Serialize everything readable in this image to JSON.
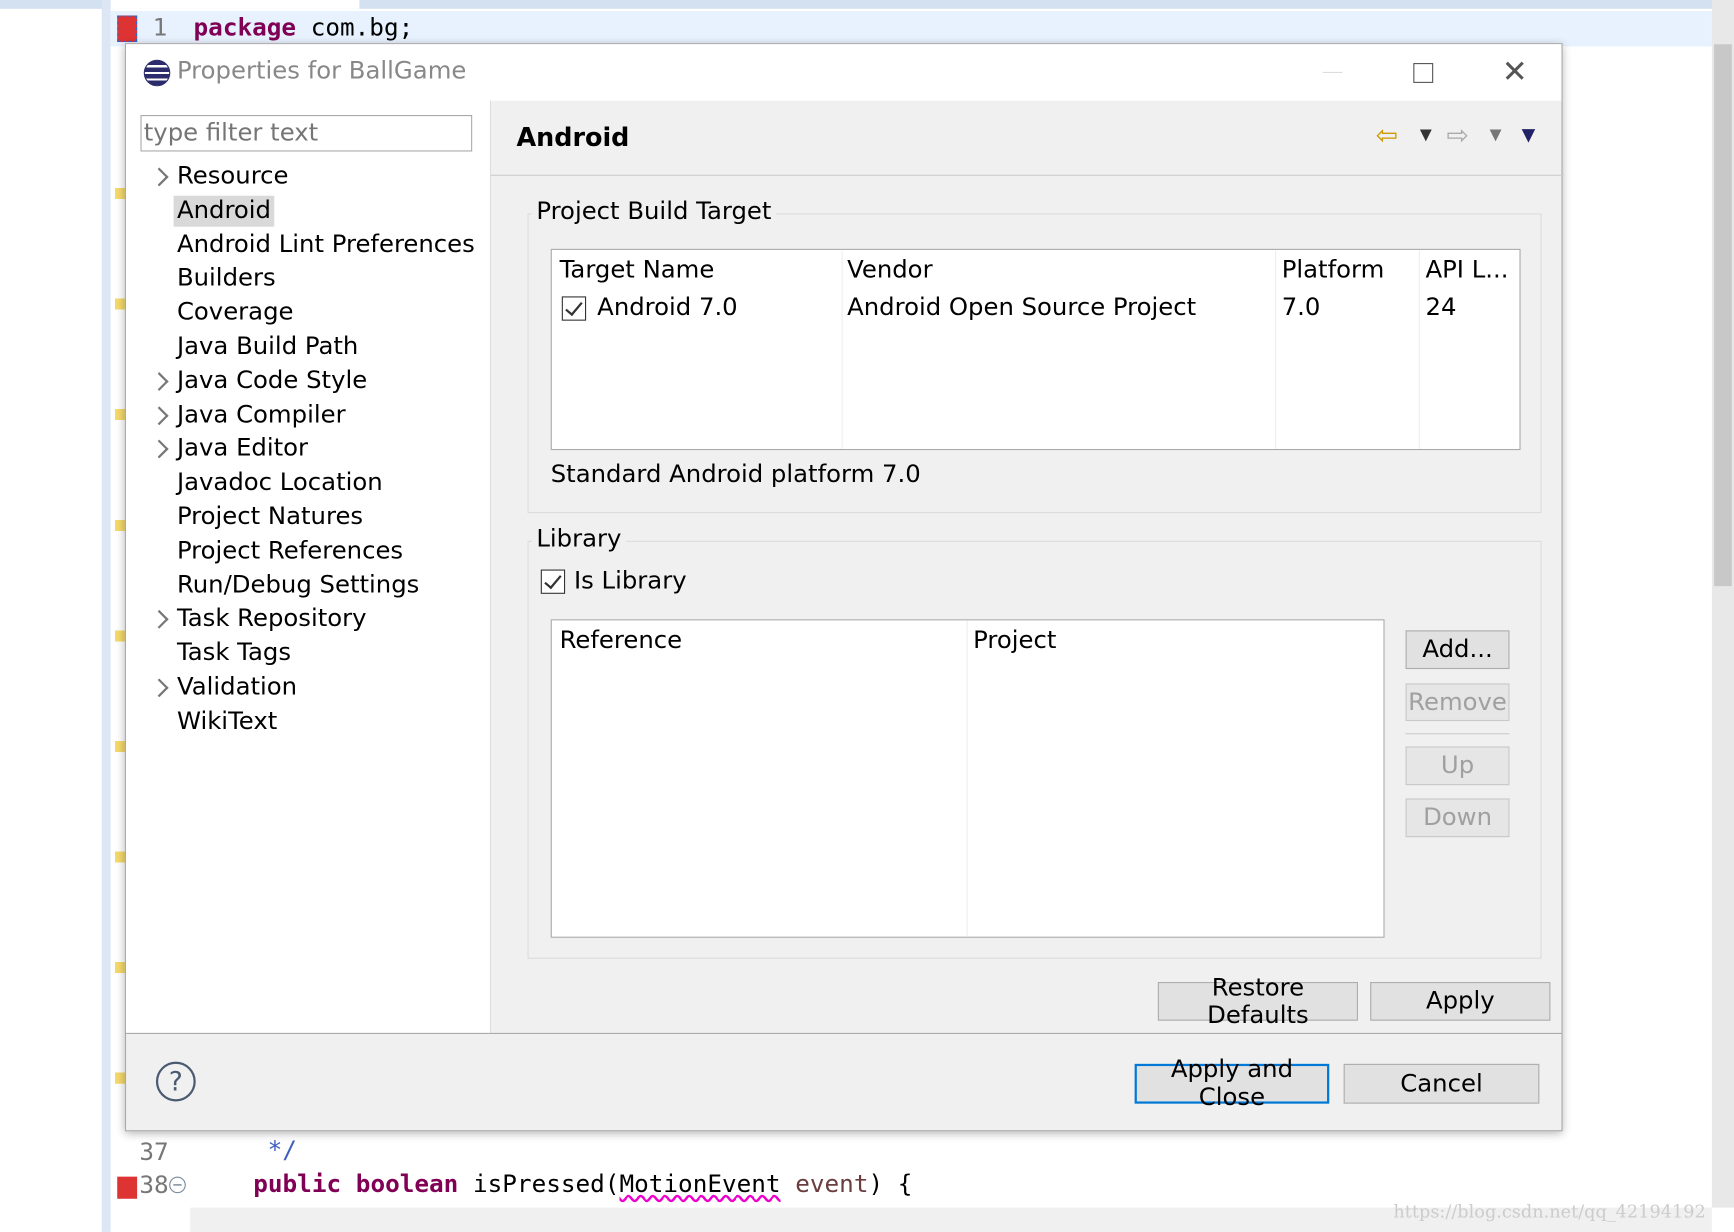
{
  "editor": {
    "line1_number": "1",
    "line1_kw": "package",
    "line1_rest": " com.bg;",
    "line37_number": "37",
    "line37_code": "*/",
    "line38_number": "38",
    "line38_kw1": "public",
    "line38_kw2": "boolean",
    "line38_rest1": " isPressed(",
    "line38_type": "MotionEvent",
    "line38_param": " event",
    ") {": "",
    "line38_rest2": ") {"
  },
  "dialog": {
    "title": "Properties for BallGame",
    "filter_placeholder": "type filter text",
    "tree": [
      {
        "label": "Resource",
        "expandable": true
      },
      {
        "label": "Android",
        "expandable": false,
        "selected": true
      },
      {
        "label": "Android Lint Preferences",
        "expandable": false
      },
      {
        "label": "Builders",
        "expandable": false
      },
      {
        "label": "Coverage",
        "expandable": false
      },
      {
        "label": "Java Build Path",
        "expandable": false
      },
      {
        "label": "Java Code Style",
        "expandable": true
      },
      {
        "label": "Java Compiler",
        "expandable": true
      },
      {
        "label": "Java Editor",
        "expandable": true
      },
      {
        "label": "Javadoc Location",
        "expandable": false
      },
      {
        "label": "Project Natures",
        "expandable": false
      },
      {
        "label": "Project References",
        "expandable": false
      },
      {
        "label": "Run/Debug Settings",
        "expandable": false
      },
      {
        "label": "Task Repository",
        "expandable": true
      },
      {
        "label": "Task Tags",
        "expandable": false
      },
      {
        "label": "Validation",
        "expandable": true
      },
      {
        "label": "WikiText",
        "expandable": false
      }
    ],
    "page_title": "Android",
    "build_target": {
      "group_label": "Project Build Target",
      "columns": [
        "Target Name",
        "Vendor",
        "Platform",
        "API L..."
      ],
      "rows": [
        {
          "checked": true,
          "name": "Android 7.0",
          "vendor": "Android Open Source Project",
          "platform": "7.0",
          "api": "24"
        }
      ],
      "description": "Standard Android platform 7.0"
    },
    "library": {
      "group_label": "Library",
      "is_library_label": "Is Library",
      "is_library_checked": true,
      "columns": [
        "Reference",
        "Project"
      ],
      "buttons": {
        "add": "Add...",
        "remove": "Remove",
        "up": "Up",
        "down": "Down"
      }
    },
    "restore_defaults": "Restore Defaults",
    "apply": "Apply",
    "apply_and_close": "Apply and Close",
    "cancel": "Cancel"
  },
  "watermark": "https://blog.csdn.net/qq_42194192",
  "colors": {
    "accent": "#0078d7",
    "keyword": "#7f0055",
    "panel": "#f0f0f0"
  }
}
